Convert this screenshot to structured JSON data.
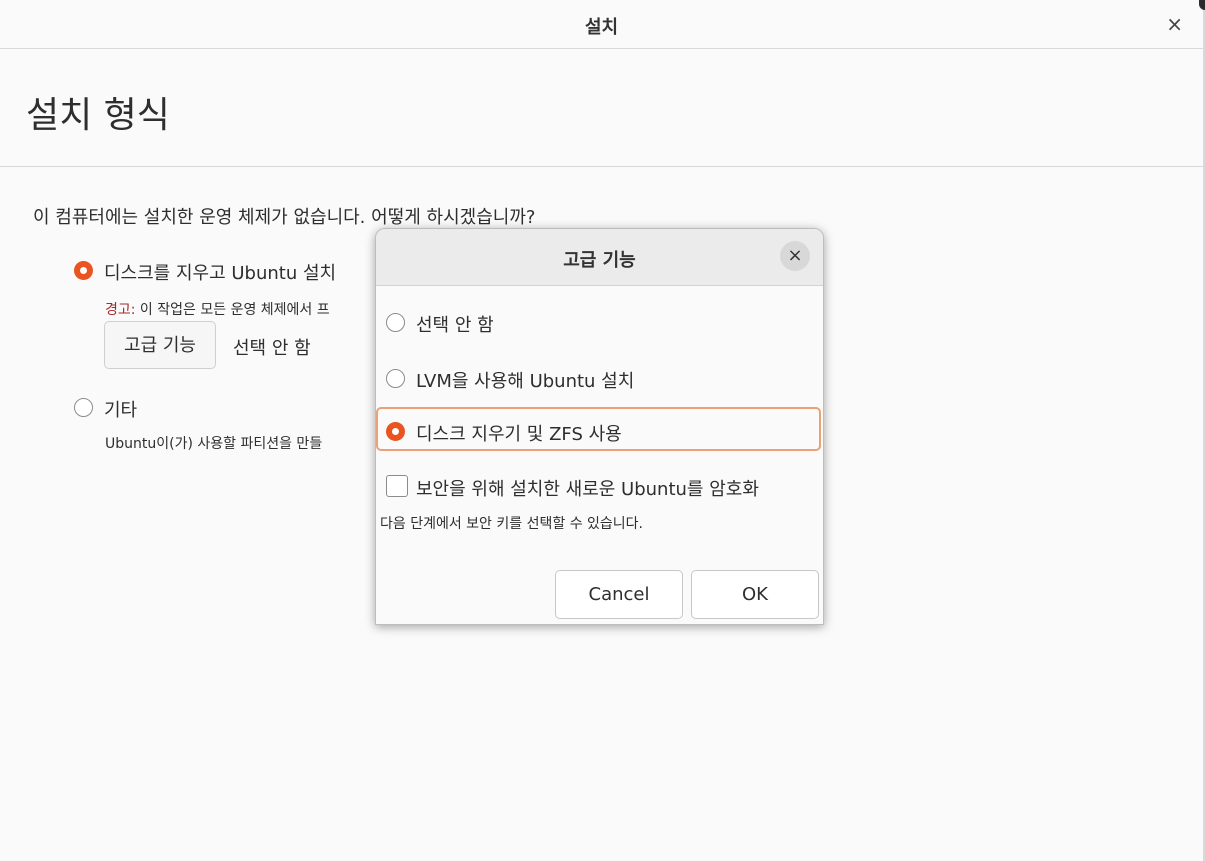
{
  "window": {
    "title": "설치",
    "close_glyph": "×"
  },
  "page": {
    "title": "설치 형식",
    "question": "이 컴퓨터에는 설치한 운영 체제가 없습니다. 어떻게 하시겠습니까?",
    "option_erase": {
      "label": "디스크를 지우고 Ubuntu 설치",
      "selected": true
    },
    "warning_label": "경고:",
    "warning_text": " 이 작업은 모든 운영 체제에서 프",
    "advanced_button": "고급 기능",
    "advanced_value": "선택 안 함",
    "option_other": {
      "label": "기타",
      "selected": false
    },
    "option_other_desc": "Ubuntu이(가) 사용할 파티션을 만들"
  },
  "dialog": {
    "title": "고급 기능",
    "close_glyph": "×",
    "options": [
      {
        "label": "선택 안 함",
        "selected": false
      },
      {
        "label": "LVM을 사용해 Ubuntu 설치",
        "selected": false
      },
      {
        "label": "디스크 지우기 및 ZFS 사용",
        "selected": true
      }
    ],
    "encrypt_label": "보안을 위해 설치한 새로운 Ubuntu를 암호화",
    "encrypt_checked": false,
    "encrypt_desc": "다음 단계에서 보안 키를 선택할 수 있습니다.",
    "cancel": "Cancel",
    "ok": "OK"
  },
  "colors": {
    "accent": "#e95420",
    "warning": "#a42a2a",
    "focus_border": "#e9a277"
  }
}
